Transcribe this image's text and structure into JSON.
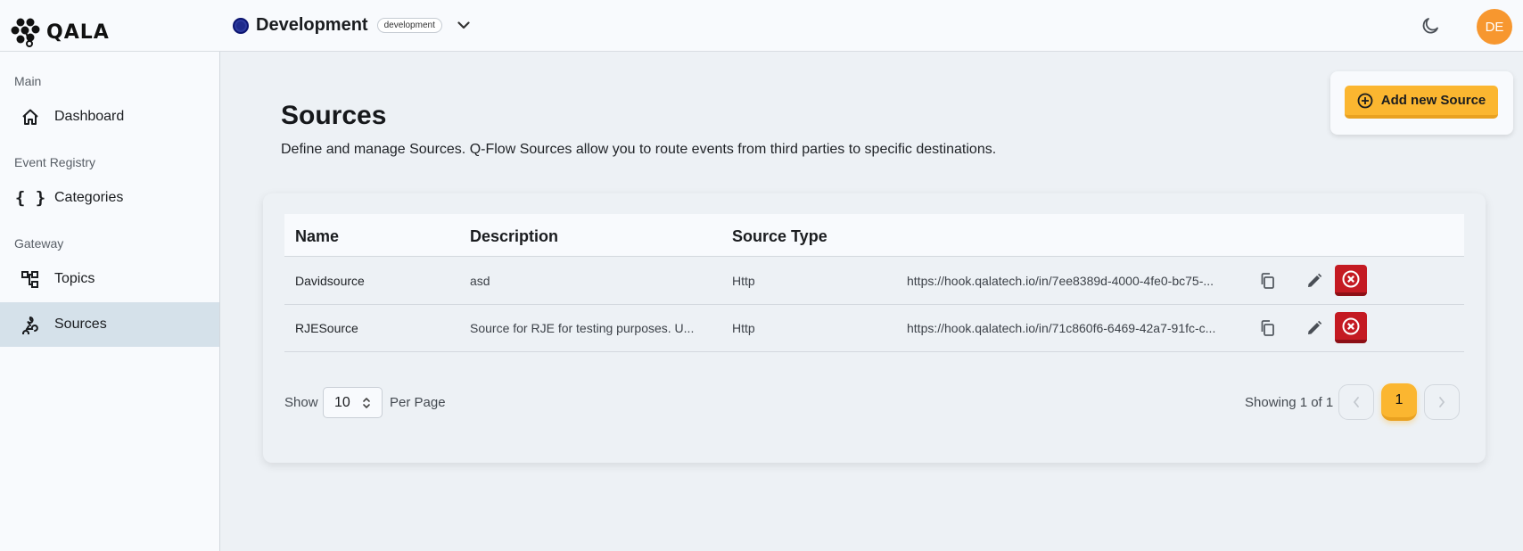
{
  "app": {
    "logo_text": "QALA"
  },
  "environment": {
    "name": "Development",
    "badge": "development"
  },
  "user": {
    "initials": "DE",
    "avatar_color": "#f7972f"
  },
  "sidebar": {
    "sections": [
      {
        "label": "Main",
        "items": [
          {
            "label": "Dashboard",
            "icon": "home-icon"
          }
        ]
      },
      {
        "label": "Event Registry",
        "items": [
          {
            "label": "Categories",
            "icon": "braces-icon"
          }
        ]
      },
      {
        "label": "Gateway",
        "items": [
          {
            "label": "Topics",
            "icon": "topics-icon"
          },
          {
            "label": "Sources",
            "icon": "webhook-icon",
            "active": true
          }
        ]
      }
    ]
  },
  "page": {
    "title": "Sources",
    "description": "Define and manage Sources. Q-Flow Sources allow you to route events from third parties to specific destinations.",
    "add_button": "Add new Source"
  },
  "table": {
    "columns": [
      "Name",
      "Description",
      "Source Type"
    ],
    "rows": [
      {
        "name": "Davidsource",
        "description": "asd",
        "type": "Http",
        "url": "https://hook.qalatech.io/in/7ee8389d-4000-4fe0-bc75-..."
      },
      {
        "name": "RJESource",
        "description": "Source for RJE for testing purposes. U...",
        "type": "Http",
        "url": "https://hook.qalatech.io/in/71c860f6-6469-42a7-91fc-c..."
      }
    ]
  },
  "pagination": {
    "show_label": "Show",
    "per_page_value": "10",
    "per_page_label": "Per Page",
    "showing": "Showing 1 of 1",
    "current_page": "1"
  },
  "colors": {
    "accent": "#fbb630",
    "danger": "#c41a22",
    "active_nav": "#d5e1ea"
  }
}
